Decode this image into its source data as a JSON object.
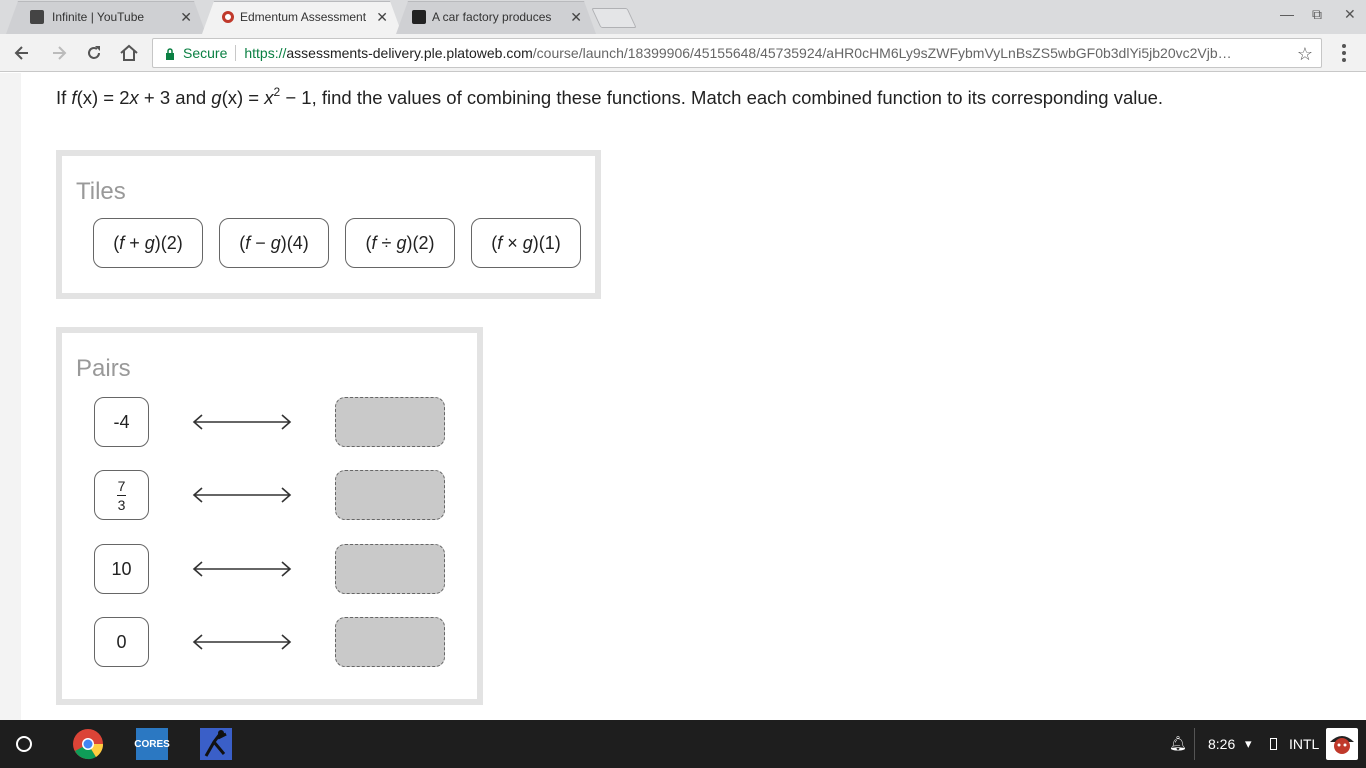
{
  "browser": {
    "tabs": [
      {
        "title": "Infinite | YouTube",
        "active": false
      },
      {
        "title": "Edmentum Assessment",
        "active": true
      },
      {
        "title": "A car factory produces",
        "active": false
      }
    ],
    "secure_label": "Secure",
    "url": {
      "scheme": "https://",
      "host": "assessments-delivery.ple.platoweb.com",
      "path": "/course/launch/18399906/45155648/45735924/aHR0cHM6Ly9sZWFybmVyLnBsZS5wbGF0b3dlYi5jb20vc2Vjb25kYXX…"
    }
  },
  "question": {
    "part1": "If ",
    "f": "f",
    "x1": "(x)",
    "eq1": " = 2",
    "x2": "x",
    "part2": " + 3 and ",
    "g": "g",
    "x3": "(x)",
    "eq2": " = ",
    "x4": "x",
    "exp": "2",
    "part3": " − 1, find the values of combining these functions. Match each combined function to its corresponding value."
  },
  "tiles": {
    "title": "Tiles",
    "items": [
      {
        "pre": "(",
        "f": "f",
        "op": " + ",
        "g": "g",
        "post": ")(2)"
      },
      {
        "pre": "(",
        "f": "f",
        "op": " − ",
        "g": "g",
        "post": ")(4)"
      },
      {
        "pre": "(",
        "f": "f",
        "op": " ÷ ",
        "g": "g",
        "post": ")(2)"
      },
      {
        "pre": "(",
        "f": "f",
        "op": " × ",
        "g": "g",
        "post": ")(1)"
      }
    ]
  },
  "pairs": {
    "title": "Pairs",
    "items": [
      {
        "value": "-4"
      },
      {
        "numerator": "7",
        "denominator": "3"
      },
      {
        "value": "10"
      },
      {
        "value": "0"
      }
    ]
  },
  "taskbar": {
    "time": "8:26",
    "input_method": "INTL",
    "cores_label": "CORES"
  }
}
